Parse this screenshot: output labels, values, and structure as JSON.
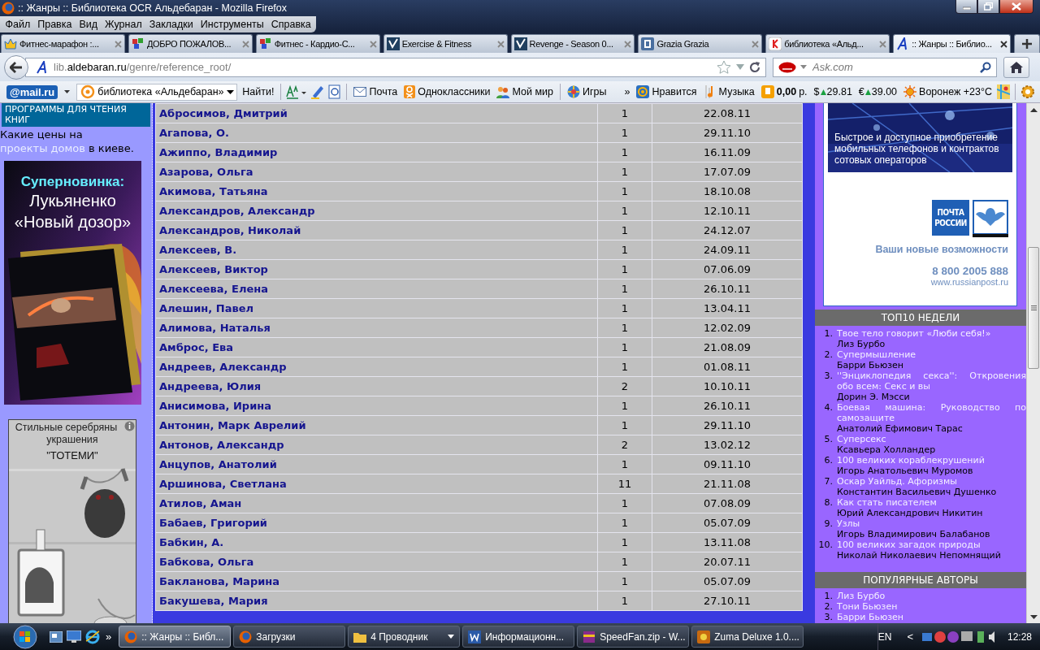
{
  "window": {
    "title": ":: Жанры :: Библиотека OCR Альдебаран - Mozilla Firefox"
  },
  "menu": [
    "Файл",
    "Правка",
    "Вид",
    "Журнал",
    "Закладки",
    "Инструменты",
    "Справка"
  ],
  "tabs": [
    {
      "label": "Фитнес-марафон :...",
      "selected": false
    },
    {
      "label": "ДОБРО ПОЖАЛОВ...",
      "selected": false
    },
    {
      "label": "Фитнес - Кардио-С...",
      "selected": false
    },
    {
      "label": "Exercise & Fitness",
      "selected": false
    },
    {
      "label": "Revenge - Season 0...",
      "selected": false
    },
    {
      "label": "Grazia Grazia",
      "selected": false
    },
    {
      "label": "библиотека «Альд...",
      "selected": false
    },
    {
      "label": ":: Жанры :: Библио...",
      "selected": true
    }
  ],
  "address_bar": {
    "prefix": "lib.",
    "domain": "aldebaran.ru",
    "path": "/genre/reference_root/"
  },
  "search": {
    "placeholder": "Ask.com"
  },
  "toolbar": {
    "logo": "@mail.ru",
    "query": "библиотека «Альдебаран»",
    "find": "Найти!",
    "items": [
      {
        "kind": "link",
        "label": "Почта"
      },
      {
        "kind": "link",
        "label": "Одноклассники"
      },
      {
        "kind": "link",
        "label": "Мой мир"
      },
      {
        "kind": "link",
        "label": "Игры"
      },
      {
        "kind": "more",
        "label": "»"
      },
      {
        "kind": "link",
        "label": "Нравится"
      },
      {
        "kind": "link",
        "label": "Музыка"
      },
      {
        "kind": "balance",
        "value": "0,00",
        "unit": "р."
      },
      {
        "kind": "currency",
        "symbol": "$",
        "value": "29.81"
      },
      {
        "kind": "currency",
        "symbol": "€",
        "value": "39.00"
      },
      {
        "kind": "link",
        "label": "Воронеж +23°C"
      }
    ]
  },
  "left_sidebar": {
    "heading": "ПРОГРАММЫ ДЛЯ ЧТЕНИЯ КНИГ",
    "promo": {
      "before": "Какие цены на ",
      "link": "проекты домов",
      "after": " в киеве."
    },
    "ads": [
      {
        "kind": "book",
        "lines": [
          "Суперновинка:",
          "Лукьяненко",
          "«Новый дозор»"
        ]
      },
      {
        "kind": "jewelry",
        "lines": [
          "Стильные серебряны",
          "украшения",
          "\"ТОТЕМИ\""
        ]
      }
    ]
  },
  "table": {
    "rows": [
      {
        "name": "Абросимов, Дмитрий",
        "count": "1",
        "date": "22.08.11"
      },
      {
        "name": "Агапова, О.",
        "count": "1",
        "date": "29.11.10"
      },
      {
        "name": "Ажиппо, Владимир",
        "count": "1",
        "date": "16.11.09"
      },
      {
        "name": "Азарова, Ольга",
        "count": "1",
        "date": "17.07.09"
      },
      {
        "name": "Акимова, Татьяна",
        "count": "1",
        "date": "18.10.08"
      },
      {
        "name": "Александров, Александр",
        "count": "1",
        "date": "12.10.11"
      },
      {
        "name": "Александров, Николай",
        "count": "1",
        "date": "24.12.07"
      },
      {
        "name": "Алексеев, В.",
        "count": "1",
        "date": "24.09.11"
      },
      {
        "name": "Алексеев, Виктор",
        "count": "1",
        "date": "07.06.09"
      },
      {
        "name": "Алексеева, Елена",
        "count": "1",
        "date": "26.10.11"
      },
      {
        "name": "Алешин, Павел",
        "count": "1",
        "date": "13.04.11"
      },
      {
        "name": "Алимова, Наталья",
        "count": "1",
        "date": "12.02.09"
      },
      {
        "name": "Амброс, Ева",
        "count": "1",
        "date": "21.08.09"
      },
      {
        "name": "Андреев, Александр",
        "count": "1",
        "date": "01.08.11"
      },
      {
        "name": "Андреева, Юлия",
        "count": "2",
        "date": "10.10.11"
      },
      {
        "name": "Анисимова, Ирина",
        "count": "1",
        "date": "26.10.11"
      },
      {
        "name": "Антонин, Марк Аврелий",
        "count": "1",
        "date": "29.11.10"
      },
      {
        "name": "Антонов, Александр",
        "count": "2",
        "date": "13.02.12"
      },
      {
        "name": "Анцупов, Анатолий",
        "count": "1",
        "date": "09.11.10"
      },
      {
        "name": "Аршинова, Светлана",
        "count": "11",
        "date": "21.11.08"
      },
      {
        "name": "Атилов, Аман",
        "count": "1",
        "date": "07.08.09"
      },
      {
        "name": "Бабаев, Григорий",
        "count": "1",
        "date": "05.07.09"
      },
      {
        "name": "Бабкин, А.",
        "count": "1",
        "date": "13.11.08"
      },
      {
        "name": "Бабкова, Ольга",
        "count": "1",
        "date": "20.07.11"
      },
      {
        "name": "Бакланова, Марина",
        "count": "1",
        "date": "05.07.09"
      },
      {
        "name": "Бакушева, Мария",
        "count": "1",
        "date": "27.10.11"
      }
    ]
  },
  "right_sidebar": {
    "ad": {
      "caption": "Быстрое и доступное приобретение мобильных телефонов и контрактов сотовых операторов",
      "logo": [
        "ПОЧТА",
        "РОССИИ"
      ],
      "slogan": "Ваши новые возможности",
      "phone": "8 800 2005 888",
      "site": "www.russianpost.ru"
    },
    "sections": [
      {
        "title": "ТОП10 НЕДЕЛИ",
        "items": [
          {
            "num": "1.",
            "title": "Твое тело говорит «Люби себя!»",
            "author": "Лиз Бурбо"
          },
          {
            "num": "2.",
            "title": "Супермышление",
            "author": "Барри Бьюзен"
          },
          {
            "num": "3.",
            "title": "''Энциклопедия секса'': Откровения обо всем: Секс и вы",
            "author": "Дорин Э. Мэсси"
          },
          {
            "num": "4.",
            "title": "Боевая машина: Руководство по самозащите",
            "author": "Анатолий Ефимович Тарас"
          },
          {
            "num": "5.",
            "title": "Суперсекс",
            "author": "Ксавьера Холландер"
          },
          {
            "num": "6.",
            "title": "100 великих кораблекрушений",
            "author": "Игорь Анатольевич Муромов"
          },
          {
            "num": "7.",
            "title": "Оскар Уайльд. Афоризмы",
            "author": "Константин Васильевич Душенко"
          },
          {
            "num": "8.",
            "title": "Как стать писателем",
            "author": "Юрий Александрович Никитин"
          },
          {
            "num": "9.",
            "title": "Узлы",
            "author": "Игорь Владимирович Балабанов"
          },
          {
            "num": "10.",
            "title": "100 великих загадок природы",
            "author": "Николай Николаевич Непомнящий"
          }
        ]
      },
      {
        "title": "ПОПУЛЯРНЫЕ АВТОРЫ",
        "items": [
          {
            "num": "1.",
            "name": "Лиз Бурбо"
          },
          {
            "num": "2.",
            "name": "Тони Бьюзен"
          },
          {
            "num": "3.",
            "name": "Барри Бьюзен"
          }
        ]
      }
    ]
  },
  "taskbar": {
    "quick_more": "»",
    "items": [
      {
        "label": ":: Жанры :: Библ...",
        "selected": true
      },
      {
        "label": "Загрузки",
        "selected": false
      },
      {
        "label": "4 Проводник",
        "selected": false
      },
      {
        "label": "Информационн...",
        "selected": false
      },
      {
        "label": "SpeedFan.zip - W...",
        "selected": false
      },
      {
        "label": "Zuma Deluxe 1.0....",
        "selected": false
      }
    ],
    "language": "EN",
    "expand": "<",
    "clock": "12:28"
  }
}
